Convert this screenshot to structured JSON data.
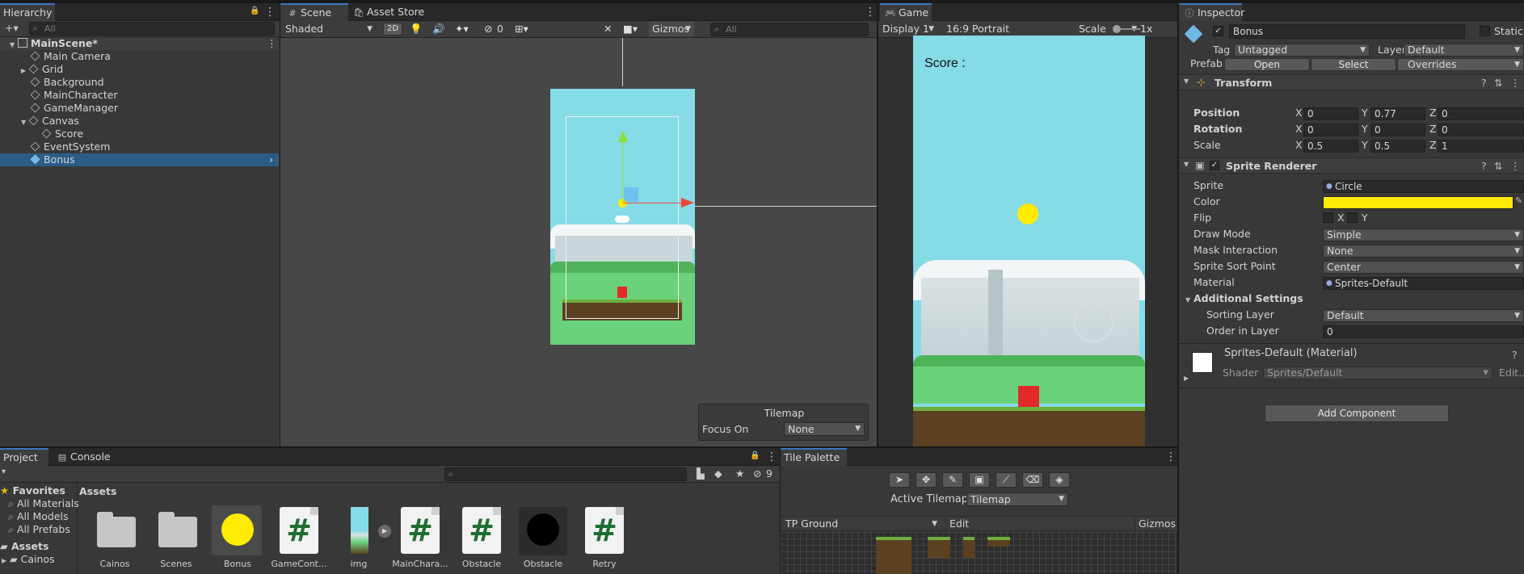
{
  "hierarchy": {
    "tab": "Hierarchy",
    "search_placeholder": "All",
    "scene": "MainScene*",
    "items": [
      {
        "label": "Main Camera"
      },
      {
        "label": "Grid"
      },
      {
        "label": "Background"
      },
      {
        "label": "MainCharacter"
      },
      {
        "label": "GameManager"
      },
      {
        "label": "Canvas"
      },
      {
        "label": "Score"
      },
      {
        "label": "EventSystem"
      },
      {
        "label": "Bonus"
      }
    ]
  },
  "scene_view": {
    "tabs": [
      "Scene",
      "Asset Store"
    ],
    "shading": "Shaded",
    "mode_2d": "2D",
    "hidden_count": "0",
    "gizmos": "Gizmos",
    "search_placeholder": "All",
    "overlay": {
      "title": "Tilemap",
      "focus_label": "Focus On",
      "focus_value": "None"
    }
  },
  "game_view": {
    "tab": "Game",
    "display": "Display 1",
    "aspect": "16:9 Portrait",
    "scale_label": "Scale",
    "scale_value": "1x",
    "score_text": "Score :"
  },
  "inspector": {
    "tab": "Inspector",
    "object_name": "Bonus",
    "static_label": "Static",
    "tag_label": "Tag",
    "tag_value": "Untagged",
    "layer_label": "Layer",
    "layer_value": "Default",
    "prefab_label": "Prefab",
    "prefab_open": "Open",
    "prefab_select": "Select",
    "prefab_overrides": "Overrides",
    "transform": {
      "title": "Transform",
      "position_label": "Position",
      "position": {
        "x": "0",
        "y": "0.77",
        "z": "0"
      },
      "rotation_label": "Rotation",
      "rotation": {
        "x": "0",
        "y": "0",
        "z": "0"
      },
      "scale_label": "Scale",
      "scale": {
        "x": "0.5",
        "y": "0.5",
        "z": "1"
      },
      "axis_x": "X",
      "axis_y": "Y",
      "axis_z": "Z"
    },
    "sprite_renderer": {
      "title": "Sprite Renderer",
      "sprite_label": "Sprite",
      "sprite_value": "Circle",
      "color_label": "Color",
      "color_value": "#ffeb04",
      "flip_label": "Flip",
      "flip_x": "X",
      "flip_y": "Y",
      "draw_mode_label": "Draw Mode",
      "draw_mode_value": "Simple",
      "mask_label": "Mask Interaction",
      "mask_value": "None",
      "sort_point_label": "Sprite Sort Point",
      "sort_point_value": "Center",
      "material_label": "Material",
      "material_value": "Sprites-Default",
      "additional_label": "Additional Settings",
      "sorting_layer_label": "Sorting Layer",
      "sorting_layer_value": "Default",
      "order_label": "Order in Layer",
      "order_value": "0"
    },
    "material": {
      "title": "Sprites-Default (Material)",
      "shader_label": "Shader",
      "shader_value": "Sprites/Default",
      "edit_label": "Edit..."
    },
    "add_component": "Add Component"
  },
  "project": {
    "tabs": [
      "Project",
      "Console"
    ],
    "hidden_count": "9",
    "favorites_label": "Favorites",
    "favorites": [
      "All Materials",
      "All Models",
      "All Prefabs"
    ],
    "assets_label": "Assets",
    "tree_items": [
      "Cainos"
    ],
    "breadcrumb": "Assets",
    "assets": [
      {
        "name": "Cainos",
        "kind": "folder"
      },
      {
        "name": "Scenes",
        "kind": "folder"
      },
      {
        "name": "Bonus",
        "kind": "yellow-circle"
      },
      {
        "name": "GameCont...",
        "kind": "script"
      },
      {
        "name": "img",
        "kind": "image"
      },
      {
        "name": "MainChara...",
        "kind": "script"
      },
      {
        "name": "Obstacle",
        "kind": "script"
      },
      {
        "name": "Obstacle",
        "kind": "black-circle"
      },
      {
        "name": "Retry",
        "kind": "script"
      }
    ]
  },
  "tile_palette": {
    "tab": "Tile Palette",
    "active_label": "Active Tilemap",
    "active_value": "Tilemap",
    "palette": "TP Ground",
    "edit": "Edit",
    "gizmos": "Gizmos"
  },
  "colors": {
    "accent": "#3a79bb",
    "selection": "#2c5d87",
    "sky": "#85dbe6",
    "ground": "#6ad27a",
    "player": "#e22a2a",
    "bonus": "#ffeb04"
  }
}
